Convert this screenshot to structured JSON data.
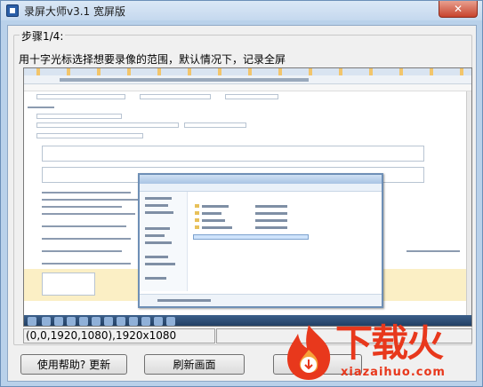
{
  "window": {
    "title": "录屏大师v3.1 宽屏版",
    "close_label": "✕"
  },
  "step": {
    "legend": "步骤1/4:",
    "instruction": "用十字光标选择想要录像的范围，默认情况下，记录全屏"
  },
  "status": {
    "region": "(0,0,1920,1080),1920x1080"
  },
  "buttons": {
    "help": "使用帮助? 更新",
    "refresh": "刷新画面"
  },
  "watermark": {
    "brand": "下载火",
    "url": "xiazaihuo.com",
    "accent": "#e8381c"
  },
  "icons": {
    "app": "app-icon",
    "close": "close-icon",
    "logo": "flame-logo-icon"
  }
}
